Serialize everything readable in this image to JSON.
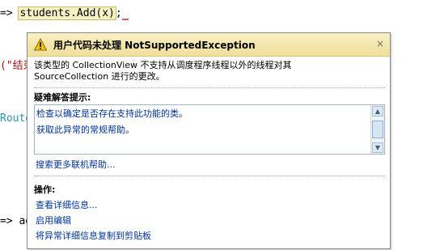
{
  "editor": {
    "line1_prefix": "=> ",
    "line1_code": "students.Add(x)",
    "line1_suffix": ";",
    "line2": "(\"结束",
    "line3": "Route",
    "line4": "=> ad"
  },
  "dialog": {
    "title": "用户代码未处理 NotSupportedException",
    "close_label": "×",
    "message_line1": "该类型的 CollectionView 不支持从调度程序线程以外的线程对其",
    "message_line2": "SourceCollection 进行的更改。",
    "tips_title": "疑难解答提示:",
    "tips": [
      "检查以确定是否存在支持此功能的类。",
      "获取此异常的常规帮助。"
    ],
    "search_link": "搜索更多联机帮助...",
    "actions_title": "操作:",
    "actions": [
      "查看详细信息...",
      "启用编辑",
      "将异常详细信息复制到剪贴板"
    ]
  },
  "icons": {
    "warning": "warning-icon",
    "close": "close-icon"
  },
  "colors": {
    "header": "#f3e6a8",
    "link": "#003399",
    "string": "#a31515",
    "type": "#2b91af"
  }
}
